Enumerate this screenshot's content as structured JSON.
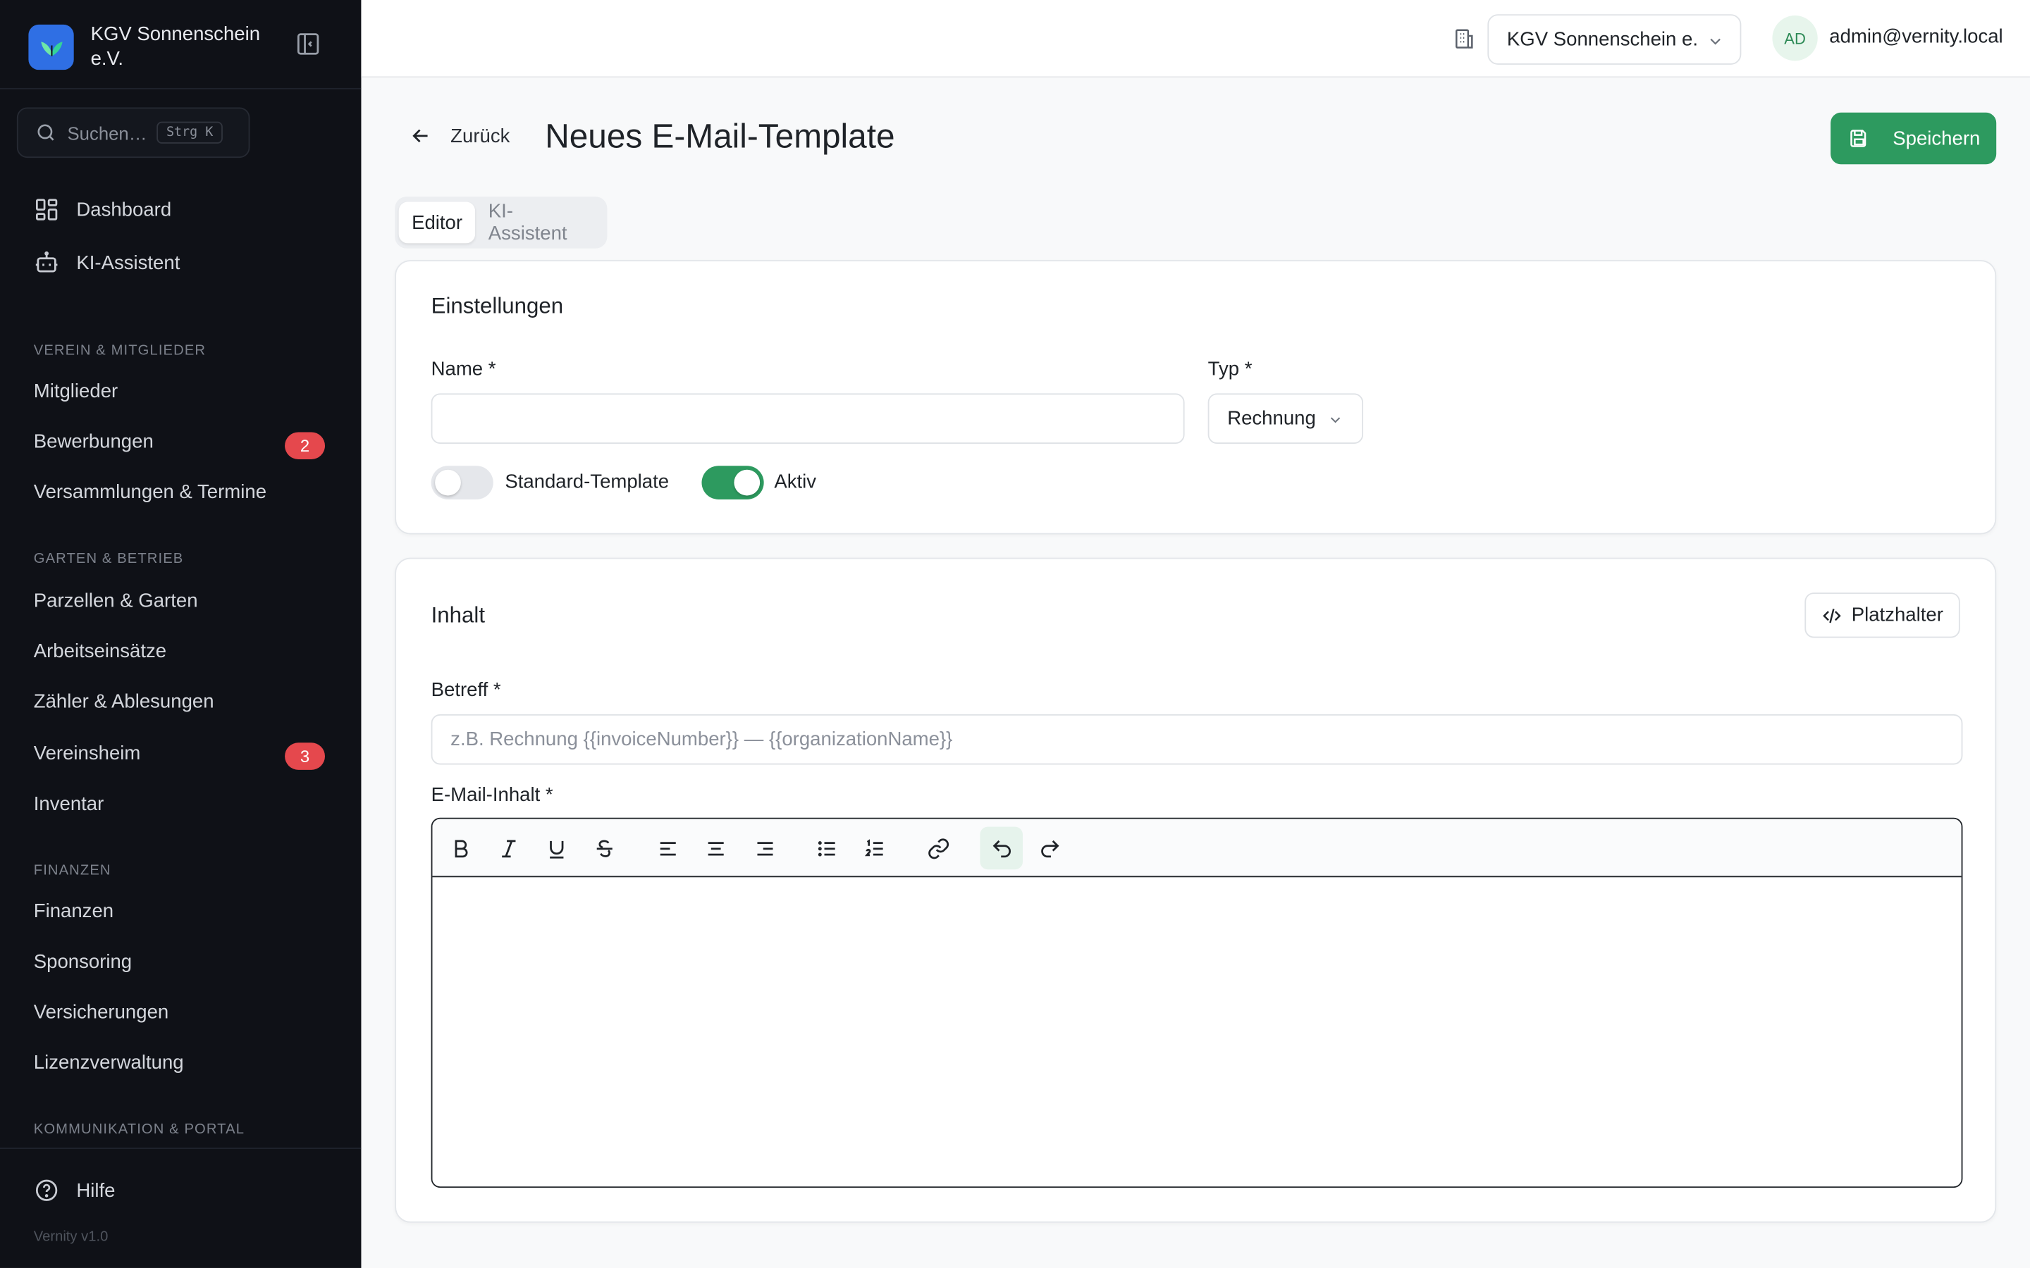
{
  "app": {
    "org_name": "KGV Sonnenschein e.V.",
    "version": "Vernity v1.0"
  },
  "sidebar": {
    "search_placeholder": "Suchen…",
    "search_shortcut": "Strg K",
    "top_items": [
      {
        "label": "Dashboard",
        "icon": "dashboard-icon"
      },
      {
        "label": "KI-Assistent",
        "icon": "robot-icon"
      }
    ],
    "sections": [
      {
        "heading": "VEREIN & MITGLIEDER",
        "items": [
          {
            "label": "Mitglieder"
          },
          {
            "label": "Bewerbungen",
            "badge": "2"
          },
          {
            "label": "Versammlungen & Termine"
          }
        ]
      },
      {
        "heading": "GARTEN & BETRIEB",
        "items": [
          {
            "label": "Parzellen & Garten"
          },
          {
            "label": "Arbeitseinsätze"
          },
          {
            "label": "Zähler & Ablesungen"
          },
          {
            "label": "Vereinsheim",
            "badge": "3"
          },
          {
            "label": "Inventar"
          }
        ]
      },
      {
        "heading": "FINANZEN",
        "items": [
          {
            "label": "Finanzen"
          },
          {
            "label": "Sponsoring"
          },
          {
            "label": "Versicherungen"
          },
          {
            "label": "Lizenzverwaltung"
          }
        ]
      },
      {
        "heading": "KOMMUNIKATION & PORTAL",
        "items": []
      }
    ],
    "help_label": "Hilfe"
  },
  "topbar": {
    "org_select_value": "KGV Sonnenschein e.",
    "avatar_initials": "AD",
    "user_email": "admin@vernity.local"
  },
  "header": {
    "back_label": "Zurück",
    "title": "Neues E-Mail-Template",
    "save_label": "Speichern"
  },
  "tabs": [
    {
      "label": "Editor",
      "active": true
    },
    {
      "label": "KI-Assistent",
      "active": false
    }
  ],
  "settings": {
    "title": "Einstellungen",
    "name_label": "Name *",
    "name_value": "",
    "type_label": "Typ *",
    "type_value": "Rechnung",
    "standard_toggle_label": "Standard-Template",
    "standard_toggle_on": false,
    "active_toggle_label": "Aktiv",
    "active_toggle_on": true
  },
  "content": {
    "title": "Inhalt",
    "placeholder_button": "Platzhalter",
    "subject_label": "Betreff *",
    "subject_placeholder": "z.B. Rechnung {{invoiceNumber}} — {{organizationName}}",
    "body_label": "E-Mail-Inhalt *",
    "toolbar": [
      "bold-icon",
      "italic-icon",
      "underline-icon",
      "strikethrough-icon",
      "align-left-icon",
      "align-center-icon",
      "align-right-icon",
      "bullet-list-icon",
      "ordered-list-icon",
      "link-icon",
      "undo-icon",
      "redo-icon"
    ]
  },
  "colors": {
    "accent": "#2d9a5f",
    "sidebar_bg": "#0f1117",
    "badge": "#e5484d",
    "brand": "#2f6fe4"
  }
}
